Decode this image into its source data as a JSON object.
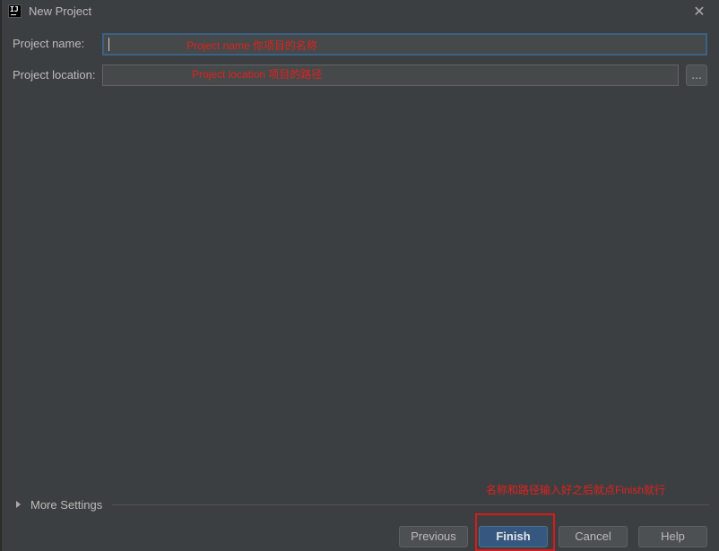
{
  "window": {
    "title": "New Project",
    "logo_text": "IJ",
    "close_icon": "✕"
  },
  "form": {
    "project_name_label": "Project name:",
    "project_name_value": "",
    "project_location_label": "Project location:",
    "project_location_value": "",
    "browse_label": "..."
  },
  "annotations": {
    "name_note": "Project name 你项目的名称",
    "location_note": "Project location 项目的路径",
    "finish_note": "名称和路径输入好之后就点Finish就行"
  },
  "more_settings": {
    "label": "More Settings"
  },
  "buttons": {
    "previous": "Previous",
    "finish": "Finish",
    "cancel": "Cancel",
    "help": "Help"
  },
  "colors": {
    "background": "#3c3f41",
    "input_background": "#45494a",
    "focus_border": "#3d6185",
    "primary_button": "#365880",
    "annotation_red": "#e0221e"
  },
  "icons": {
    "app_logo": "intellij-logo-icon",
    "close": "close-icon",
    "expand": "triangle-right-icon"
  }
}
